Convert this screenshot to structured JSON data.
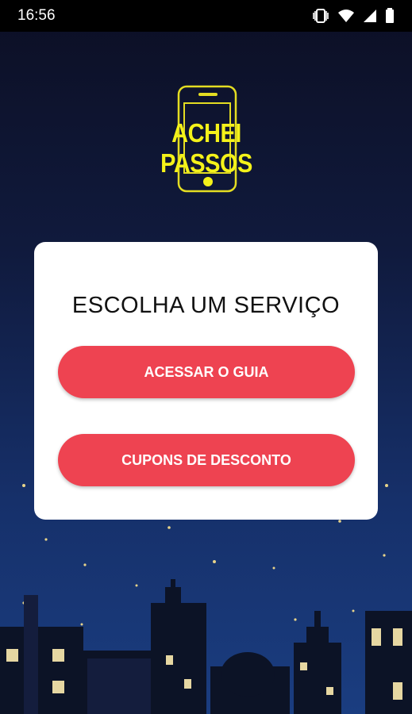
{
  "status_bar": {
    "time": "16:56",
    "icons": [
      "vibrate-icon",
      "wifi-icon",
      "signal-icon",
      "battery-icon"
    ]
  },
  "logo": {
    "text": "ACHEI PASSOS",
    "color": "#f4f21a"
  },
  "card": {
    "title": "ESCOLHA UM SERVIÇO",
    "buttons": [
      {
        "label": "ACESSAR O GUIA"
      },
      {
        "label": "CUPONS DE DESCONTO"
      }
    ]
  },
  "colors": {
    "accent": "#ee4351",
    "background_top": "#0c0f24",
    "background_bottom": "#1a3d80"
  }
}
